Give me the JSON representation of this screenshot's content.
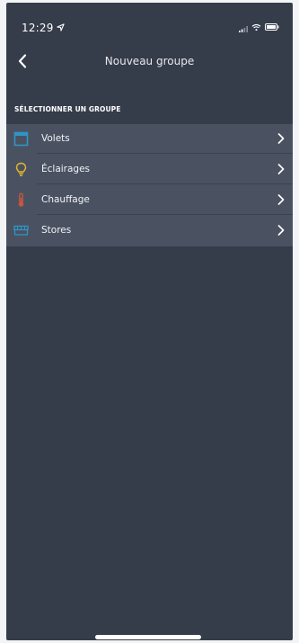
{
  "status_bar": {
    "time": "12:29",
    "icons": [
      "location-icon",
      "signal-icon",
      "wifi-icon",
      "battery-icon"
    ]
  },
  "nav": {
    "back_icon": "chevron-left-icon",
    "title": "Nouveau groupe"
  },
  "section": {
    "header": "SÉLECTIONNER UN GROUPE"
  },
  "groups": {
    "items": [
      {
        "label": "Volets",
        "icon": "shutter-icon",
        "icon_color": "#2f95c8"
      },
      {
        "label": "Éclairages",
        "icon": "lightbulb-icon",
        "icon_color": "#e0b52a"
      },
      {
        "label": "Chauffage",
        "icon": "thermometer-icon",
        "icon_color": "#c7563c"
      },
      {
        "label": "Stores",
        "icon": "awning-icon",
        "icon_color": "#2f95c8"
      }
    ]
  },
  "colors": {
    "background": "#353c4a",
    "list_background": "#4a5262",
    "text": "#f1f3f6"
  }
}
